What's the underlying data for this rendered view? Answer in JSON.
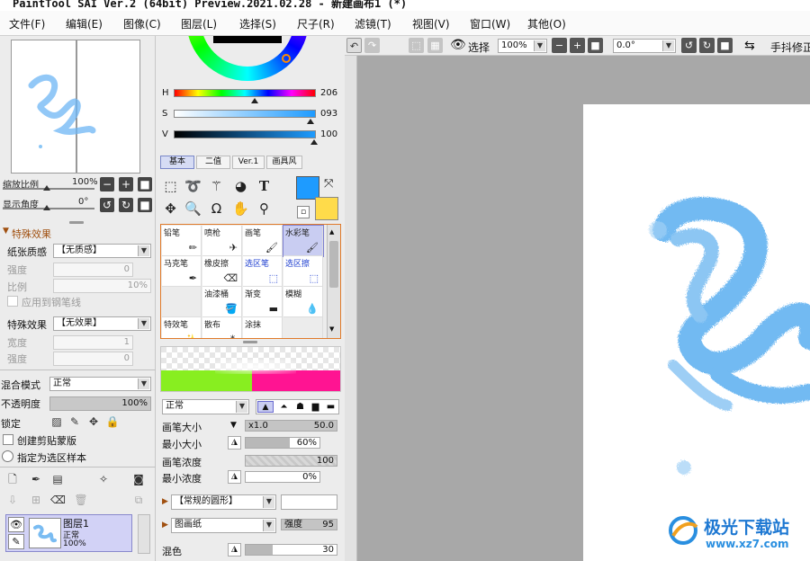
{
  "window": {
    "title": "PaintTool SAI Ver.2 (64bit) Preview.2021.02.28 - 新建画布1 (*)"
  },
  "menu": [
    "文件(F)",
    "编辑(E)",
    "图像(C)",
    "图层(L)",
    "选择(S)",
    "尺子(R)",
    "滤镜(T)",
    "视图(V)",
    "窗口(W)",
    "其他(O)"
  ],
  "navigator": {
    "zoom_label": "缩放比例",
    "zoom_value": "100%",
    "angle_label": "显示角度",
    "angle_value": "0°"
  },
  "special_effects": {
    "header": "特殊效果",
    "paper_label": "纸张质感",
    "paper_value": "【无质感】",
    "strength_label": "强度",
    "strength_value": "0",
    "scale_label": "比例",
    "scale_value": "10%",
    "apply_pen_label": "应用到钢笔线",
    "effect_label": "特殊效果",
    "effect_value": "【无效果】",
    "width_label": "宽度",
    "width_value": "1",
    "effect_strength_label": "强度",
    "effect_strength_value": "0"
  },
  "layer_props": {
    "blend_label": "混合模式",
    "blend_value": "正常",
    "opacity_label": "不透明度",
    "opacity_value": "100%",
    "lock_label": "锁定",
    "clip_label": "创建剪贴蒙版",
    "selection_source_label": "指定为选区样本"
  },
  "layers": [
    {
      "name": "图层1",
      "mode": "正常",
      "opacity": "100%"
    }
  ],
  "color": {
    "h_label": "H",
    "h_value": "206",
    "s_label": "S",
    "s_value": "093",
    "v_label": "V",
    "v_value": "100",
    "fg_color": "#1e9bff",
    "bg_color": "#ffdb4a",
    "tabs": [
      "基本",
      "二值",
      "Ver.1",
      "画具风"
    ]
  },
  "brushes": [
    {
      "name": "铅笔",
      "style": "normal"
    },
    {
      "name": "喷枪",
      "style": "normal"
    },
    {
      "name": "画笔",
      "style": "normal"
    },
    {
      "name": "水彩笔",
      "style": "selected"
    },
    {
      "name": "马克笔",
      "style": "normal"
    },
    {
      "name": "橡皮擦",
      "style": "normal"
    },
    {
      "name": "选区笔",
      "style": "blue"
    },
    {
      "name": "选区擦",
      "style": "blue"
    },
    {
      "name": "",
      "style": "empty"
    },
    {
      "name": "油漆桶",
      "style": "normal"
    },
    {
      "name": "渐变",
      "style": "normal"
    },
    {
      "name": "模糊",
      "style": "normal"
    },
    {
      "name": "特效笔",
      "style": "normal"
    },
    {
      "name": "散布",
      "style": "normal"
    },
    {
      "name": "涂抹",
      "style": "normal"
    },
    {
      "name": "",
      "style": "empty"
    }
  ],
  "brush_settings": {
    "mode_value": "正常",
    "size_label": "画笔大小",
    "size_multiplier": "x1.0",
    "size_value": "50.0",
    "min_size_label": "最小大小",
    "min_size_value": "60%",
    "min_size_fraction": 0.6,
    "density_label": "画笔浓度",
    "density_value": "100",
    "min_density_label": "最小浓度",
    "min_density_value": "0%",
    "shape_value": "【常规的圆形】",
    "texture_value": "图画纸",
    "texture_strength_label": "强度",
    "texture_strength_value": "95",
    "blend_label": "混色",
    "blend_value": "30",
    "blend_fraction": 0.3
  },
  "canvas_toolbar": {
    "selection_label": "选择",
    "zoom_value": "100%",
    "angle_value": "0.0°",
    "stabilizer_label": "手抖修正"
  },
  "watermark": {
    "title": "极光下载站",
    "url": "www.xz7.com"
  }
}
